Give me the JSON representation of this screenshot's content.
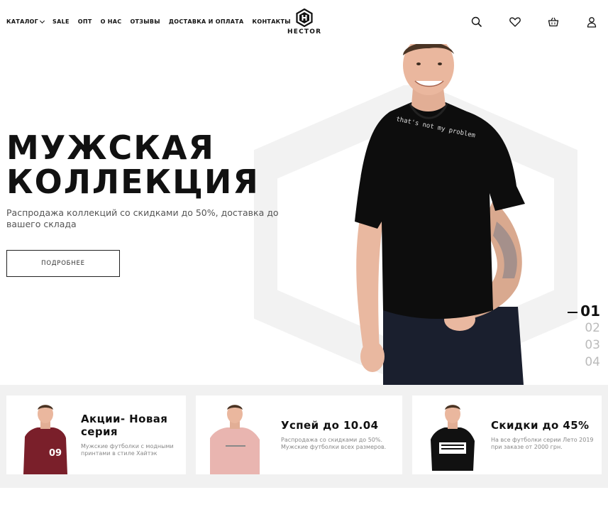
{
  "nav": {
    "items": [
      {
        "label": "КАТАЛОГ",
        "dropdown": true
      },
      {
        "label": "SALE"
      },
      {
        "label": "ОПТ"
      },
      {
        "label": "О НАС"
      },
      {
        "label": "ОТЗЫВЫ"
      },
      {
        "label": "ДОСТАВКА И ОПЛАТА"
      },
      {
        "label": "КОНТАКТЫ"
      }
    ]
  },
  "logo": {
    "text": "HECTOR"
  },
  "header_icons": [
    "search-icon",
    "heart-icon",
    "basket-icon",
    "user-icon"
  ],
  "hero": {
    "title_line1": "МУЖСКАЯ",
    "title_line2": "КОЛЛЕКЦИЯ",
    "subtitle": "Распродажа коллекций со скидками до 50%, доставка до вашего склада",
    "button": "ПОДРОБНЕЕ",
    "tshirt_text": "that's not my problem"
  },
  "slides": {
    "active": "01",
    "items": [
      "01",
      "02",
      "03",
      "04"
    ]
  },
  "cards": [
    {
      "title": "Акции- Новая серия",
      "desc": "Мужские футболки с модными принтами в стиле Хайтэк",
      "shirt_color": "#7a1f2a"
    },
    {
      "title": "Успей до 10.04",
      "desc": "Распродажа со скидками до 50%. Мужские футболки всех размеров.",
      "shirt_color": "#e9b5b0"
    },
    {
      "title": "Скидки до 45%",
      "desc": "На все футболки серии Лето 2019 при заказе от 2000 грн.",
      "shirt_color": "#111111"
    }
  ],
  "colors": {
    "accent": "#111111",
    "strip_bg": "#f1f1f1",
    "hex": "#f3f3f3"
  }
}
